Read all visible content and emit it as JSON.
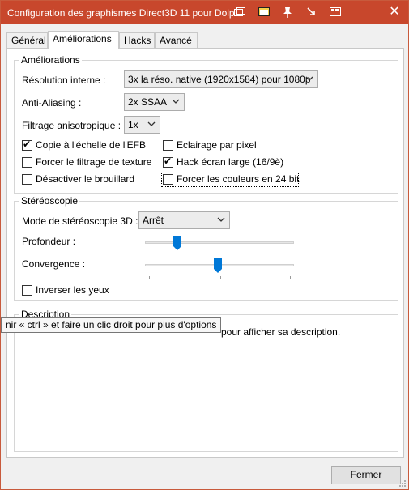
{
  "window": {
    "title": "Configuration des graphismes Direct3D 11 pour Dolp..."
  },
  "titlebar_icons": [
    "restore-window-icon",
    "frame-icon",
    "pin-icon",
    "shrink-icon",
    "windows-icon"
  ],
  "tabs": [
    {
      "label": "Général"
    },
    {
      "label": "Améliorations"
    },
    {
      "label": "Hacks"
    },
    {
      "label": "Avancé"
    }
  ],
  "ameliorations": {
    "group_title": "Améliorations",
    "resolution": {
      "label": "Résolution interne :",
      "value": "3x la réso. native (1920x1584) pour 1080p"
    },
    "antialiasing": {
      "label": "Anti-Aliasing :",
      "value": "2x SSAA"
    },
    "anisotropic": {
      "label": "Filtrage anisotropique :",
      "value": "1x"
    },
    "checkboxes": [
      {
        "label": "Copie à l'échelle de l'EFB",
        "checked": true
      },
      {
        "label": "Eclairage par pixel",
        "checked": false
      },
      {
        "label": "Forcer le filtrage de texture",
        "checked": false
      },
      {
        "label": "Hack écran large (16/9è)",
        "checked": true
      },
      {
        "label": "Désactiver le brouillard",
        "checked": false
      },
      {
        "label": "Forcer les couleurs en 24 bit",
        "checked": false
      }
    ]
  },
  "stereo": {
    "group_title": "Stéréoscopie",
    "mode_label": "Mode de stéréoscopie 3D :",
    "mode_value": "Arrêt",
    "depth_label": "Profondeur :",
    "depth_level": 0.22,
    "convergence_label": "Convergence :",
    "convergence_level": 0.49,
    "swap_eyes_label": "Inverser les yeux",
    "swap_eyes_checked": false
  },
  "description": {
    "group_title": "Description",
    "text": "pour afficher sa description."
  },
  "tooltip": {
    "text": "nir « ctrl » et faire un clic droit pour plus d'options"
  },
  "footer": {
    "close_label": "Fermer"
  }
}
